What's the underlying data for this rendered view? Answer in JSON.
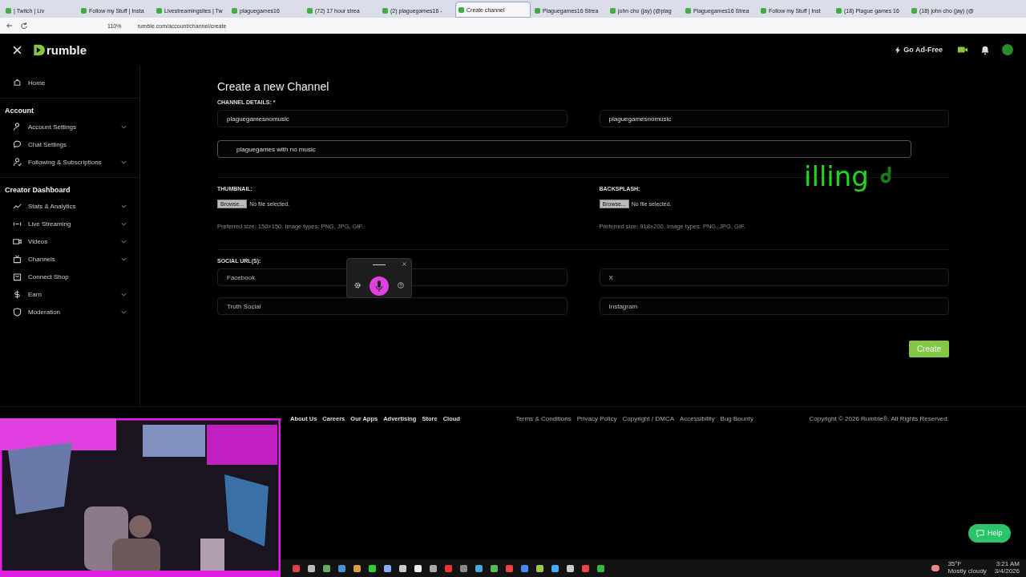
{
  "browser": {
    "tabs": [
      {
        "title": "| Twitch | Liv",
        "selected": false
      },
      {
        "title": "Follow my Stuff | Insta",
        "selected": false
      },
      {
        "title": "Livestreamingsites | Tw",
        "selected": false
      },
      {
        "title": "plaguegames16",
        "selected": false
      },
      {
        "title": "(72) 17 hour strea",
        "selected": false
      },
      {
        "title": "(2) plaguegames16 -",
        "selected": false
      },
      {
        "title": "Create channel",
        "selected": true
      },
      {
        "title": "Plaguegames16 Strea",
        "selected": false
      },
      {
        "title": "john cho (jay) (@plag",
        "selected": false
      },
      {
        "title": "Plaguegames16 Strea",
        "selected": false
      },
      {
        "title": "Follow my Stuff | Inst",
        "selected": false
      },
      {
        "title": "(18) Plague games 16",
        "selected": false
      },
      {
        "title": "(18) john cho (jay) (@",
        "selected": false
      }
    ],
    "zoom": "110%",
    "url": "rumble.com/account/channel/create"
  },
  "header": {
    "logo": "rumble",
    "ad_free": "Go Ad-Free"
  },
  "sidebar": {
    "home": {
      "label": "Home"
    },
    "sections": [
      {
        "title": "Account",
        "items": [
          {
            "label": "Account Settings",
            "expandable": true
          },
          {
            "label": "Chat Settings",
            "expandable": false
          },
          {
            "label": "Following & Subscriptions",
            "expandable": true
          }
        ]
      },
      {
        "title": "Creator Dashboard",
        "items": [
          {
            "label": "Stats & Analytics",
            "expandable": true
          },
          {
            "label": "Live Streaming",
            "expandable": true
          },
          {
            "label": "Videos",
            "expandable": true
          },
          {
            "label": "Channels",
            "expandable": true
          },
          {
            "label": "Connect Shop",
            "expandable": false
          },
          {
            "label": "Earn",
            "expandable": true
          },
          {
            "label": "Moderation",
            "expandable": true
          }
        ]
      }
    ]
  },
  "form": {
    "title": "Create a new Channel",
    "details_label": "CHANNEL DETAILS: *",
    "fields": [
      {
        "value": "plaguegamesnomusic"
      },
      {
        "value": "plaguegamesnomusic"
      }
    ],
    "description": "plaguegames with no music",
    "uploads": [
      {
        "label": "THUMBNAIL:",
        "button": "Browse...",
        "status": "No file selected.",
        "hint": "Preferred size: 150×150. Image types: PNG, JPG, GIF."
      },
      {
        "label": "BACKSPLASH:",
        "button": "Browse...",
        "status": "No file selected.",
        "hint": "Preferred size: 918×200. Image types: PNG, JPG, GIF."
      }
    ],
    "social_label": "SOCIAL URL(S):",
    "social_fields": [
      {
        "placeholder": "Facebook"
      },
      {
        "placeholder": "X"
      },
      {
        "placeholder": "Truth Social"
      },
      {
        "placeholder": "Instagram"
      }
    ],
    "create": "Create"
  },
  "footer": {
    "links": [
      "About Us",
      "Careers",
      "Our Apps",
      "Advertising",
      "Store",
      "Cloud"
    ],
    "legal": [
      "Terms & Conditions",
      "Privacy Policy",
      "Copyright / DMCA",
      "Accessibility",
      "Bug Bounty"
    ],
    "copyright": "Copyright © 2026 Rumble®. All Rights Reserved."
  },
  "caption": "illing",
  "help": "Help",
  "taskbar": {
    "temp": "35°F",
    "weather": "Mostly cloudy",
    "time": "3:21 AM",
    "date": "3/4/2026"
  }
}
